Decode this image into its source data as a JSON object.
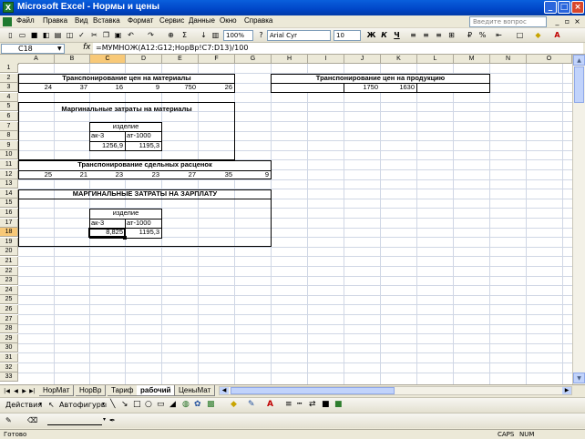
{
  "window": {
    "title": "Microsoft Excel - Нормы и цены"
  },
  "menu": [
    "Файл",
    "Правка",
    "Вид",
    "Вставка",
    "Формат",
    "Сервис",
    "Данные",
    "Окно",
    "Справка"
  ],
  "help": {
    "placeholder": "Введите вопрос"
  },
  "toolbar": {
    "zoom": "100%",
    "font": "Arial Cyr",
    "size": "10",
    "bold": "Ж",
    "italic": "К",
    "underline": "Ч",
    "sigma": "Σ",
    "percent": "%"
  },
  "formula_bar": {
    "cell": "C18",
    "fx": "fx",
    "formula": "=МУМНОЖ(A12:G12;НорВр!C7:D13)/100"
  },
  "columns": [
    "A",
    "B",
    "C",
    "D",
    "E",
    "F",
    "G",
    "H",
    "I",
    "J",
    "K",
    "L",
    "M",
    "N",
    "O"
  ],
  "rows": [
    "1",
    "2",
    "3",
    "4",
    "5",
    "6",
    "7",
    "8",
    "9",
    "10",
    "11",
    "12",
    "13",
    "14",
    "15",
    "16",
    "17",
    "18",
    "19",
    "20",
    "21",
    "22",
    "23",
    "24",
    "25",
    "26",
    "27",
    "28",
    "29",
    "30",
    "31",
    "32",
    "33",
    "34"
  ],
  "cells": {
    "r2_title": "Транспонирование цен на материалы",
    "r2_title2": "Транспонирование цен на продукцию",
    "r3": [
      "24",
      "37",
      "16",
      "9",
      "750",
      "26"
    ],
    "r3_j": "1750",
    "r3_k": "1630",
    "r5_title": "Маргинальные затраты на материалы",
    "r7_c": "изделие",
    "r8_c": "ак-3",
    "r8_d": "ат-1000",
    "r9_c": "1256,9",
    "r9_d": "1195,3",
    "r11_title": "Транспонирование сдельных расценок",
    "r12": [
      "25",
      "21",
      "23",
      "23",
      "27",
      "35",
      "9"
    ],
    "r14_title": "МАРГИНАЛЬНЫЕ ЗАТРАТЫ НА ЗАРПЛАТУ",
    "r16_c": "изделие",
    "r17_c": "ак-3",
    "r17_d": "ат-1000",
    "r18_c": "8,825",
    "r18_d": "1195,3"
  },
  "tabs": [
    "НорМат",
    "НорВр",
    "Тариф",
    "рабочий",
    "ЦеныМат"
  ],
  "active_tab": "рабочий",
  "drawbar": {
    "actions": "Действия",
    "autoshapes": "Автофигуры"
  },
  "status": {
    "left": "Готово",
    "caps": "CAPS",
    "num": "NUM"
  }
}
